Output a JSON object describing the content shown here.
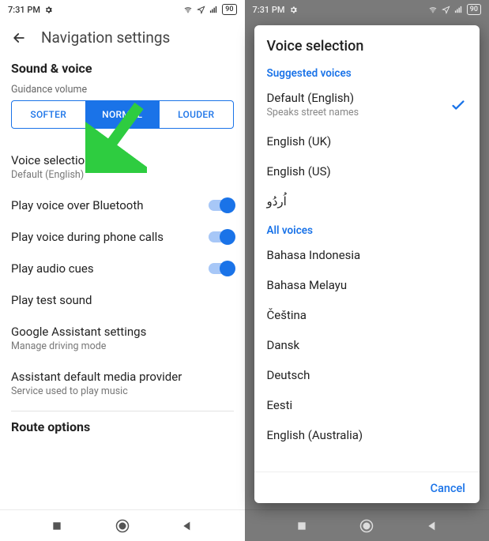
{
  "status": {
    "time": "7:31 PM",
    "battery": "90"
  },
  "left": {
    "header": "Navigation settings",
    "section_sound": "Sound & voice",
    "guidance_label": "Guidance volume",
    "seg": {
      "softer": "SOFTER",
      "normal": "NORMAL",
      "louder": "LOUDER"
    },
    "voice_selection": {
      "title": "Voice selection",
      "sub": "Default (English)"
    },
    "bluetooth": "Play voice over Bluetooth",
    "during_calls": "Play voice during phone calls",
    "audio_cues": "Play audio cues",
    "test_sound": "Play test sound",
    "assistant": {
      "title": "Google Assistant settings",
      "sub": "Manage driving mode"
    },
    "media_provider": {
      "title": "Assistant default media provider",
      "sub": "Service used to play music"
    },
    "route_options": "Route options"
  },
  "right": {
    "title": "Voice selection",
    "suggested_label": "Suggested voices",
    "all_label": "All voices",
    "suggested": [
      {
        "name": "Default (English)",
        "sub": "Speaks street names",
        "selected": true
      },
      {
        "name": "English (UK)"
      },
      {
        "name": "English (US)"
      },
      {
        "name": "اُردُو"
      }
    ],
    "all": [
      {
        "name": "Bahasa Indonesia"
      },
      {
        "name": "Bahasa Melayu"
      },
      {
        "name": "Čeština"
      },
      {
        "name": "Dansk"
      },
      {
        "name": "Deutsch"
      },
      {
        "name": "Eesti"
      },
      {
        "name": "English (Australia)"
      }
    ],
    "cancel": "Cancel"
  }
}
